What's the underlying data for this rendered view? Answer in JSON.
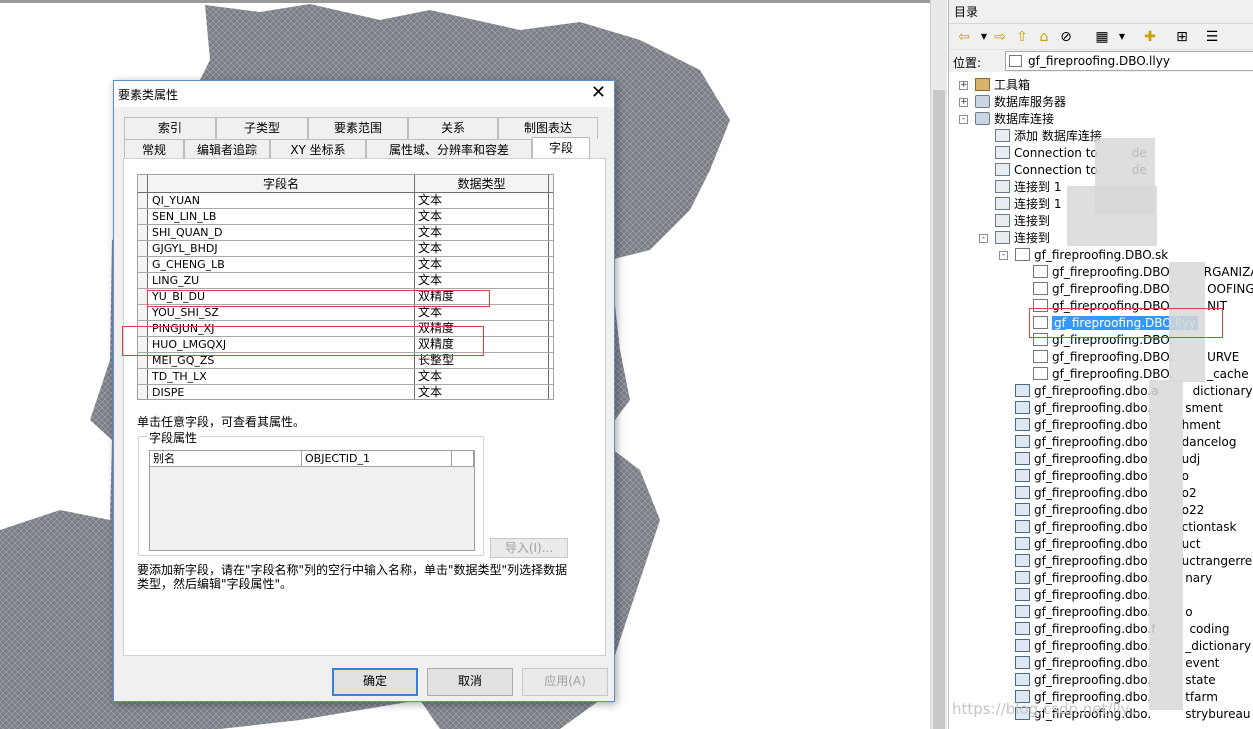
{
  "colors": {
    "accent": "#3c7fd6",
    "selection": "#3399ff",
    "highlight_box": "#e04040",
    "map_fill": "#7a7d84"
  },
  "dialog": {
    "title": "要素类属性",
    "close_glyph": "✕",
    "tabs_row1": [
      "索引",
      "子类型",
      "要素范围",
      "关系",
      "制图表达"
    ],
    "tabs_row2": [
      "常规",
      "编辑者追踪",
      "XY 坐标系",
      "属性域、分辨率和容差",
      "字段"
    ],
    "active_tab": "字段",
    "grid": {
      "col_name": "字段名",
      "col_type": "数据类型",
      "rows": [
        {
          "name": "QI_YUAN",
          "type": "文本"
        },
        {
          "name": "SEN_LIN_LB",
          "type": "文本"
        },
        {
          "name": "SHI_QUAN_D",
          "type": "文本"
        },
        {
          "name": "GJGYL_BHDJ",
          "type": "文本"
        },
        {
          "name": "G_CHENG_LB",
          "type": "文本"
        },
        {
          "name": "LING_ZU",
          "type": "文本"
        },
        {
          "name": "YU_BI_DU",
          "type": "双精度"
        },
        {
          "name": "YOU_SHI_SZ",
          "type": "文本"
        },
        {
          "name": "PINGJUN_XJ",
          "type": "双精度"
        },
        {
          "name": "HUO_LMGQXJ",
          "type": "双精度"
        },
        {
          "name": "MEI_GQ_ZS",
          "type": "长整型"
        },
        {
          "name": "TD_TH_LX",
          "type": "文本"
        },
        {
          "name": "DISPE",
          "type": "文本"
        }
      ]
    },
    "hint": "单击任意字段，可查看其属性。",
    "field_props": {
      "label": "字段属性",
      "rows": [
        {
          "key": "别名",
          "value": "OBJECTID_1"
        }
      ]
    },
    "import_button": "导入(I)...",
    "note": "要添加新字段，请在\"字段名称\"列的空行中输入名称，单击\"数据类型\"列选择数据类型，然后编辑\"字段属性\"。",
    "ok_button": "确定",
    "cancel_button": "取消",
    "apply_button": "应用(A)"
  },
  "catalog": {
    "title": "目录",
    "location_label": "位置:",
    "location_value": "gf_fireproofing.DBO.llyy",
    "tree": [
      {
        "label": "工具箱",
        "icon": "toolbox-icon",
        "level": 0,
        "exp": "+"
      },
      {
        "label": "数据库服务器",
        "icon": "db-server-icon",
        "level": 0,
        "exp": "+"
      },
      {
        "label": "数据库连接",
        "icon": "db-connections-icon",
        "level": 0,
        "exp": "-"
      },
      {
        "label": "添加 数据库连接",
        "icon": "add-connection-icon",
        "level": 1
      },
      {
        "label": "Connection to",
        "suffix": "de",
        "icon": "connection-icon",
        "level": 1
      },
      {
        "label": "Connection to",
        "suffix": "de",
        "icon": "connection-icon",
        "level": 1
      },
      {
        "label": "连接到 1",
        "icon": "connection-icon",
        "level": 1
      },
      {
        "label": "连接到 1",
        "icon": "connection-icon",
        "level": 1
      },
      {
        "label": "连接到",
        "icon": "connection-icon",
        "level": 1
      },
      {
        "label": "连接到",
        "icon": "connection-icon",
        "level": 1,
        "exp": "-"
      },
      {
        "label": "gf_fireproofing.DBO.sk",
        "icon": "feature-dataset-icon",
        "level": 2,
        "exp": "-"
      },
      {
        "label": "gf_fireproofing.DBO",
        "suffix": "RGANIZA",
        "icon": "point-feature-icon",
        "level": 3
      },
      {
        "label": "gf_fireproofing.DBO.",
        "suffix": "OOFING",
        "icon": "point-feature-icon",
        "level": 3
      },
      {
        "label": "gf_fireproofing.DBO.",
        "suffix": "NIT",
        "icon": "point-feature-icon",
        "level": 3
      },
      {
        "label": "gf_fireproofing.DBO.llyy",
        "icon": "polygon-feature-icon",
        "level": 3,
        "selected": true
      },
      {
        "label": "gf_fireproofing.DBO.",
        "icon": "polygon-feature-icon",
        "level": 3
      },
      {
        "label": "gf_fireproofing.DBO.",
        "suffix": "URVE",
        "icon": "point-feature-icon",
        "level": 3
      },
      {
        "label": "gf_fireproofing.DBO.",
        "suffix": "_cache",
        "icon": "polygon-feature-icon",
        "level": 3
      },
      {
        "label": "gf_fireproofing.dbo.a",
        "suffix": "dictionary",
        "icon": "table-icon",
        "level": 2
      },
      {
        "label": "gf_fireproofing.dbo.",
        "suffix": "sment",
        "icon": "table-icon",
        "level": 2
      },
      {
        "label": "gf_fireproofing.dbo",
        "suffix": "hment",
        "icon": "table-icon",
        "level": 2
      },
      {
        "label": "gf_fireproofing.dbo",
        "suffix": "dancelog",
        "icon": "table-icon",
        "level": 2
      },
      {
        "label": "gf_fireproofing.dbo",
        "suffix": "udj",
        "icon": "table-icon",
        "level": 2
      },
      {
        "label": "gf_fireproofing.dbo",
        "suffix": "o",
        "icon": "table-icon",
        "level": 2
      },
      {
        "label": "gf_fireproofing.dbo",
        "suffix": "o2",
        "icon": "table-icon",
        "level": 2
      },
      {
        "label": "gf_fireproofing.dbo",
        "suffix": "o22",
        "icon": "table-icon",
        "level": 2
      },
      {
        "label": "gf_fireproofing.dbo",
        "suffix": "ctiontask",
        "icon": "table-icon",
        "level": 2
      },
      {
        "label": "gf_fireproofing.dbo",
        "suffix": "uct",
        "icon": "table-icon",
        "level": 2
      },
      {
        "label": "gf_fireproofing.dbo",
        "suffix": "uctrangerrela",
        "icon": "table-icon",
        "level": 2
      },
      {
        "label": "gf_fireproofing.dbo.",
        "suffix": "nary",
        "icon": "table-icon",
        "level": 2
      },
      {
        "label": "gf_fireproofing.dbo.",
        "icon": "table-icon",
        "level": 2
      },
      {
        "label": "gf_fireproofing.dbo.",
        "suffix": "o",
        "icon": "table-icon",
        "level": 2
      },
      {
        "label": "gf_fireproofing.dbo.f",
        "suffix": "coding",
        "icon": "table-icon",
        "level": 2
      },
      {
        "label": "gf_fireproofing.dbo.",
        "suffix": "_dictionary",
        "icon": "table-icon",
        "level": 2
      },
      {
        "label": "gf_fireproofing.dbo.",
        "suffix": "event",
        "icon": "relationship-icon",
        "level": 2
      },
      {
        "label": "gf_fireproofing.dbo.",
        "suffix": "state",
        "icon": "table-icon",
        "level": 2
      },
      {
        "label": "gf_fireproofing.dbo.",
        "suffix": "tfarm",
        "icon": "table-icon",
        "level": 2
      },
      {
        "label": "gf_fireproofing.dbo.",
        "suffix": "strybureau",
        "icon": "table-icon",
        "level": 2
      }
    ]
  },
  "watermark": "https://blog.csdn.net/lly..."
}
